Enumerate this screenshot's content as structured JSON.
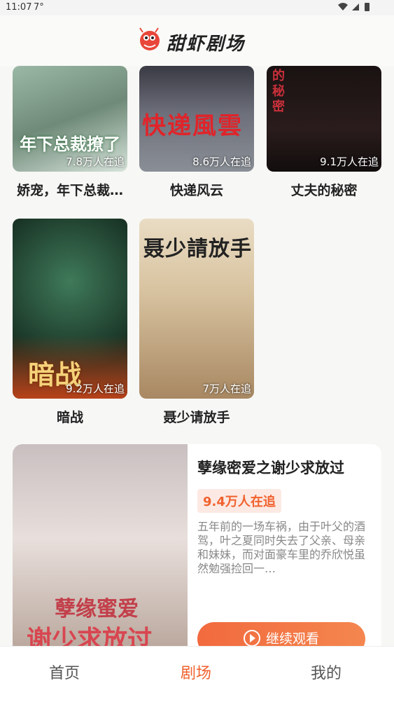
{
  "status_bar": {
    "time": "11:07",
    "temperature": "7°"
  },
  "header": {
    "app_title": "甜虾剧场"
  },
  "grid": [
    {
      "name": "娇宠，年下总裁…",
      "count": "7.8万人在追",
      "overlay": "年下总裁撩了"
    },
    {
      "name": "快递风云",
      "count": "8.6万人在追",
      "overlay": "快递風雲"
    },
    {
      "name": "丈夫的秘密",
      "count": "9.1万人在追",
      "overlay": "的秘密"
    },
    {
      "name": "暗战",
      "count": "9.2万人在追",
      "overlay": "暗战"
    },
    {
      "name": "聂少请放手",
      "count": "7万人在追",
      "overlay": "聂少請放手"
    }
  ],
  "feature": {
    "title": "孽缘密爱之谢少求放过",
    "count": "9.4万人在追",
    "description": "五年前的一场车祸，由于叶父的酒驾，叶之夏同时失去了父亲、母亲和妹妹，而对面豪车里的乔欣悦虽然勉强捡回一…",
    "button_label": "继续观看",
    "poster_text_1": "孽缘蜜爱",
    "poster_text_2": "谢少求放过"
  },
  "tabs": [
    {
      "label": "首页",
      "active": false
    },
    {
      "label": "剧场",
      "active": true
    },
    {
      "label": "我的",
      "active": false
    }
  ],
  "colors": {
    "accent": "#f0622e",
    "badge_bg": "#fde9e3"
  }
}
